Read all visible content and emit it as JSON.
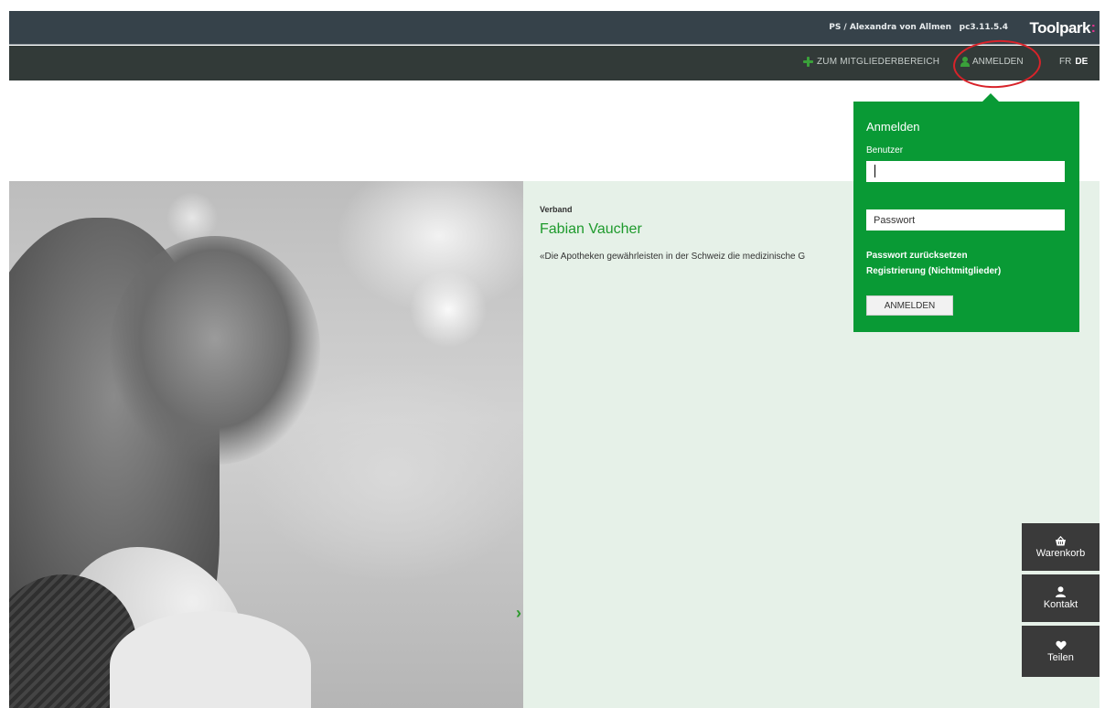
{
  "topbar": {
    "user": "PS / Alexandra von Allmen",
    "version": "pc3.11.5.4",
    "logo": "Toolpark",
    "logo_dot": ":"
  },
  "nav": {
    "member_area": "ZUM MITGLIEDERBEREICH",
    "login": "ANMELDEN",
    "lang_fr": "FR",
    "lang_de": "DE"
  },
  "hero": {
    "kicker": "Verband",
    "name": "Fabian Vaucher",
    "quote": "«Die Apotheken gewährleisten in der Schweiz die medizinische G"
  },
  "login_panel": {
    "title": "Anmelden",
    "user_label": "Benutzer",
    "user_value": "",
    "password_placeholder": "Passwort",
    "reset_link": "Passwort zurücksetzen",
    "register_link": "Registrierung (Nichtmitglieder)",
    "submit": "ANMELDEN"
  },
  "side_actions": {
    "cart": "Warenkorb",
    "contact": "Kontakt",
    "share": "Teilen"
  },
  "colors": {
    "brand_green": "#099a35",
    "topbar": "#36424a",
    "navbar": "#323a38",
    "panel_bg": "#e6f1e8",
    "annotation": "#d8232a"
  }
}
